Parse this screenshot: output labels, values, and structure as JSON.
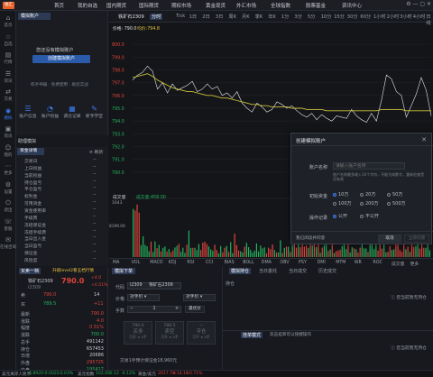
{
  "app": {
    "logo": "福汇"
  },
  "topnav": [
    "首页",
    "我的自选",
    "国内期货",
    "国际期货",
    "期权市场",
    "黄金现货",
    "外汇市场",
    "全球指数",
    "股票基金",
    "资讯中心"
  ],
  "window_controls": "⚙ — ▢ ✕",
  "leftnav": [
    {
      "label": "首页",
      "icon": "home-icon"
    },
    {
      "label": "自选",
      "icon": "star-icon"
    },
    {
      "label": "行情",
      "icon": "chart-icon"
    },
    {
      "label": "资讯",
      "icon": "news-icon"
    },
    {
      "label": "交易",
      "icon": "trade-icon"
    },
    {
      "label": "模拟",
      "icon": "gamepad-icon"
    },
    {
      "label": "资讯",
      "icon": "doc-icon"
    },
    {
      "label": "我的",
      "icon": "user-icon"
    },
    {
      "label": "更多",
      "icon": "more-icon"
    },
    {
      "label": "设置",
      "icon": "gear-icon"
    },
    {
      "label": "退出",
      "icon": "exit-icon"
    },
    {
      "label": "客服",
      "icon": "headset-icon"
    },
    {
      "label": "在线咨询",
      "icon": "chat-icon"
    }
  ],
  "account": {
    "tab": "模拟账户",
    "message": "您还没有模拟账户",
    "create_button": "创建模拟账户",
    "tip": "练手神器 · 免费使用 · 助您实战",
    "tiles": [
      "账户信息",
      "账户权益",
      "调仓记录",
      "新手学堂"
    ],
    "section": "助理模拟",
    "funds_tab": "资金详情",
    "refresh": "刷新"
  },
  "funds": [
    {
      "label": "交易日",
      "value": "--"
    },
    {
      "label": "上日权益",
      "value": "--"
    },
    {
      "label": "当前权益",
      "value": "--"
    },
    {
      "label": "持仓盈亏",
      "value": "--"
    },
    {
      "label": "平仓盈亏",
      "value": "--"
    },
    {
      "label": "权利金",
      "value": "--"
    },
    {
      "label": "可用资金",
      "value": "--"
    },
    {
      "label": "资金使用率",
      "value": "--"
    },
    {
      "label": "手续费",
      "value": "--"
    },
    {
      "label": "冻结保证金",
      "value": "--"
    },
    {
      "label": "冻结手续费",
      "value": "--"
    },
    {
      "label": "当日出入金",
      "value": "--"
    },
    {
      "label": "当日盈亏",
      "value": "--"
    },
    {
      "label": "保证金",
      "value": "--"
    },
    {
      "label": "风险度",
      "value": "--"
    }
  ],
  "chart": {
    "symbol": "铁矿石2309",
    "timeframe": "分时",
    "timeframes": [
      "Tick",
      "1日",
      "2日",
      "3日",
      "周K",
      "月K",
      "季K",
      "年K",
      "1分",
      "3分",
      "5分",
      "10分",
      "15分",
      "30分",
      "60分",
      "1小时",
      "2小时",
      "3小时",
      "4小时",
      "日线"
    ],
    "price_label": "价格: 790.0",
    "avg_label": "均价:794.8",
    "y_ticks": [
      "800.0",
      "799.0",
      "798.0",
      "797.0",
      "796.0",
      "795.0",
      "794.0",
      "793.0",
      "792.0",
      "791.0",
      "790.0"
    ],
    "volume_label": "成交量",
    "volume_value": "成交量:458.00",
    "vol_ticks": [
      "1643",
      "8199.00"
    ],
    "indicators": [
      "MA",
      "VOL",
      "MACD",
      "KDJ",
      "RSI",
      "CCI",
      "BIAS",
      "BOLL",
      "DMA",
      "OBV",
      "PSY",
      "DMI",
      "MTM",
      "WR",
      "ROC",
      "成交量",
      "更多"
    ],
    "chart_data": {
      "type": "line",
      "title": "",
      "series": [
        {
          "name": "价格",
          "values": [
            797.2,
            797.6,
            797.8,
            798.3,
            797.9,
            796.5,
            797.0,
            796.2,
            796.9,
            796.4,
            796.6,
            796.8,
            797.1,
            796.3,
            796.5,
            796.9,
            796.5,
            796.7,
            796.0,
            796.2,
            795.8,
            796.3,
            795.4,
            795.0,
            794.7,
            795.4,
            795.1,
            794.7,
            794.9,
            795.5,
            795.3,
            795.0,
            795.2,
            794.8,
            794.5,
            794.3,
            794.6,
            794.1,
            794.5,
            794.2,
            794.0,
            794.4,
            794.3,
            794.2,
            794.9,
            794.4,
            794.1,
            793.9,
            794.6,
            794.0,
            795.6,
            797.6,
            797.3,
            796.3,
            796.0,
            794.3,
            795.2,
            796.1,
            797.4,
            796.4,
            794.4
          ]
        },
        {
          "name": "均价",
          "values": [
            797.4,
            797.5,
            797.6,
            797.7,
            797.5,
            797.2,
            797.0,
            796.8,
            796.6,
            796.5,
            796.4,
            796.3,
            796.3,
            796.2,
            796.1,
            796.0,
            796.0,
            795.9,
            795.8,
            795.8,
            795.7,
            795.6,
            795.5,
            795.4,
            795.3,
            795.3,
            795.2,
            795.2,
            795.1,
            795.1,
            795.1,
            795.1,
            795.0,
            795.0,
            795.0,
            794.9,
            794.9,
            794.9,
            794.9,
            794.8,
            794.8,
            794.8,
            794.8,
            794.8,
            794.8,
            794.8,
            794.8,
            794.8,
            794.8,
            794.8,
            794.9,
            794.9,
            794.9,
            794.9,
            794.9,
            794.8,
            794.8,
            794.8,
            794.8,
            794.8,
            794.8
          ]
        }
      ],
      "ylim": [
        789,
        801
      ]
    }
  },
  "dialog": {
    "title": "创建模拟账户",
    "name_label": "账户名称",
    "name_placeholder": "请输入账户名称",
    "name_hint": "账户名称最多输入10个字符，不能为纯数字，重新检查是否有效",
    "capital_label": "初始资金",
    "capital_options": [
      "10万",
      "20万",
      "50万",
      "100万",
      "200万",
      "500万"
    ],
    "public_label": "操作记录",
    "public_options": [
      "公开",
      "不公开"
    ],
    "agreement": "我已阅读并同意",
    "cancel": "取消",
    "confirm": "立即创建"
  },
  "quote": {
    "tabs": [
      "买卖一档",
      "升级level2看五档行情"
    ],
    "symbol": "铁矿石2309",
    "code": "i2309",
    "price": "790.0",
    "change": "+4.0",
    "change_pct": "+0.51%",
    "sell_label": "卖",
    "sell_price": "790.0",
    "sell_vol": "14",
    "buy_label": "买",
    "buy_price": "789.5",
    "buy_vol": "+11",
    "stats": [
      {
        "label": "最新",
        "value": "790.0"
      },
      {
        "label": "涨跌",
        "value": "4.0"
      },
      {
        "label": "幅度",
        "value": "0.51%"
      },
      {
        "label": "涨跌",
        "value": "700.0"
      },
      {
        "label": "总手",
        "value": "491142"
      },
      {
        "label": "持仓",
        "value": "657453"
      },
      {
        "label": "日增",
        "value": "20686"
      },
      {
        "label": "外盘",
        "value": "295725"
      },
      {
        "label": "内盘",
        "value": "195417"
      }
    ]
  },
  "order": {
    "tab": "模拟下单",
    "contract_label": "代码",
    "contract": "i2309",
    "contract_name": "铁矿石2309",
    "price_label": "价格",
    "price_type": "对手价",
    "price_type2": "对手价",
    "qty_label": "手数",
    "qty": "1",
    "qty_btn": "最优价",
    "buy_label": "买多",
    "buy_price": "790.0",
    "buy_sub": "可开 ≤ 0手",
    "sell_label": "卖空",
    "sell_price": "789.5",
    "sell_sub": "可开 ≤ 0手",
    "close_label": "平仓",
    "close_price": "—",
    "close_sub": "可平 ≤ 0手",
    "margin": "交易1手预计保证金18,960元"
  },
  "positions": {
    "tabs": [
      "模拟持仓",
      "当日委托",
      "当日成交",
      "历史成交"
    ],
    "open_tab": "持仓",
    "empty_text": "您当前暂无持仓",
    "strategy_tabs": [
      "挂单模式",
      "双击挂单可以快捷操作"
    ],
    "empty_text2": "您当前暂无持仓"
  },
  "status": [
    {
      "text": "美元离岸人民币",
      "cls": ""
    },
    {
      "text": "6.8920",
      "cls": "dn"
    },
    {
      "text": "-0.0022",
      "cls": "dn"
    },
    {
      "text": "-0.03%",
      "cls": "dn"
    },
    {
      "text": "美元指数",
      "cls": ""
    },
    {
      "text": "102.05",
      "cls": "dn"
    },
    {
      "text": "-0.12",
      "cls": "dn"
    },
    {
      "text": "-0.12%",
      "cls": "dn"
    },
    {
      "text": "黄金/美元",
      "cls": ""
    },
    {
      "text": "2017.78",
      "cls": "up"
    },
    {
      "text": "+14.16",
      "cls": "up"
    },
    {
      "text": "+0.71%",
      "cls": "up"
    }
  ]
}
